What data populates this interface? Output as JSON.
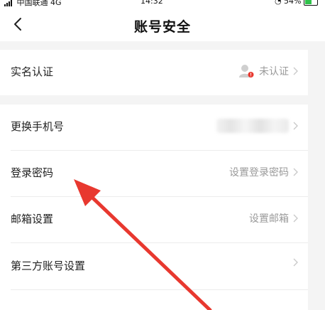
{
  "status_bar": {
    "carrier": "中国联通",
    "network": "4G",
    "time": "14:32",
    "battery": "54%"
  },
  "nav": {
    "back_icon": "chevron-left-icon",
    "title": "账号安全"
  },
  "rows": {
    "real_name": {
      "label": "实名认证",
      "value": "未认证",
      "icon": "user-unverified-icon"
    },
    "change_phone": {
      "label": "更换手机号",
      "value_blurred": true
    },
    "login_password": {
      "label": "登录密码",
      "value": "设置登录密码"
    },
    "email": {
      "label": "邮箱设置",
      "value": "设置邮箱"
    },
    "third_party": {
      "label": "第三方账号设置"
    }
  },
  "colors": {
    "background": "#f4f4f4",
    "card": "#ffffff",
    "secondary_text": "#9a9a9a",
    "annotation_arrow": "#e8382f",
    "badge": "#e8382f"
  }
}
